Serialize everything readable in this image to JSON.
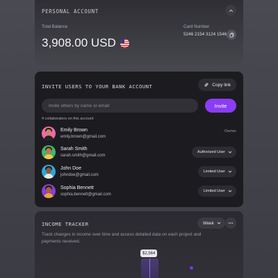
{
  "account": {
    "title": "PERSONAL ACCOUNT",
    "total_label": "Total Balance",
    "balance": "3,908.00 USD",
    "card_label": "Card Number",
    "card_number": "5246 2154 3124 1546"
  },
  "invite": {
    "title": "INVITE USERS TO YOUR BANK ACCOUNT",
    "copy_link": "Copy link",
    "placeholder": "Invite others by name or email",
    "invite_button": "Invite",
    "collaborators": "4 collaborators on this account",
    "users": [
      {
        "name": "Emily Brown",
        "email": "emily.brown@gmail.com",
        "role": "Owner"
      },
      {
        "name": "Sarah Smith",
        "email": "sarah.smith@gmail.com",
        "role": "Authorized User"
      },
      {
        "name": "John Doe",
        "email": "johndoe@gmail.com",
        "role": "Limited User"
      },
      {
        "name": "Sophia Bennett",
        "email": "sophia.bennett@gmail.com",
        "role": "Limited User"
      }
    ]
  },
  "income": {
    "title": "INCOME TRACKER",
    "period": "Week",
    "description": "Track changes in income over time and access detailed data on each project and payments received.",
    "tooltip": "$2,564"
  },
  "colors": {
    "accent": "#8b3cf5",
    "card_dark": "#1c1c20"
  }
}
